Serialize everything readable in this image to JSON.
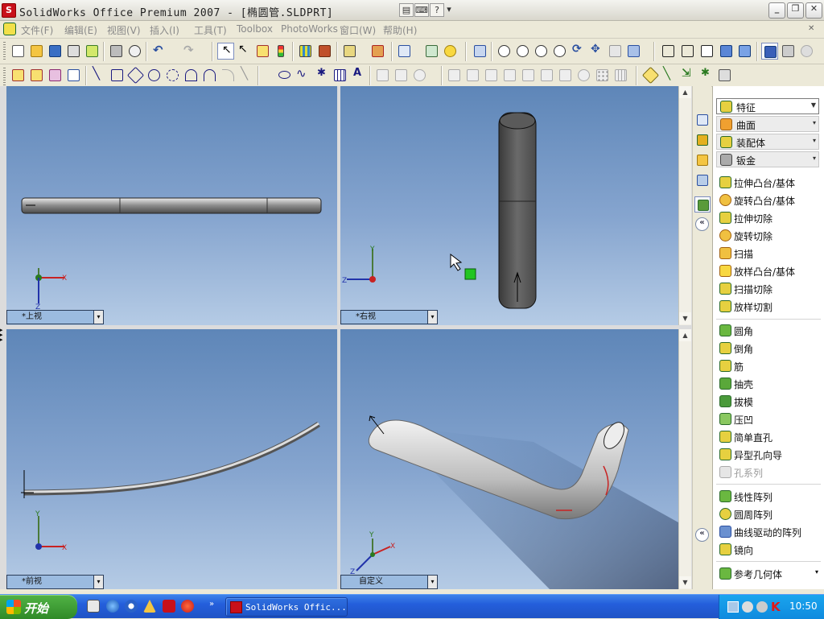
{
  "window": {
    "title": "SolidWorks Office Premium 2007 - [椭圆管.SLDPRT]",
    "logo_text": "S"
  },
  "menu": [
    "文件(F)",
    "编辑(E)",
    "视图(V)",
    "插入(I)",
    "工具(T)",
    "Toolbox",
    "PhotoWorks",
    "窗口(W)",
    "帮助(H)"
  ],
  "viewports": {
    "top_left": {
      "label": "*上视"
    },
    "top_right": {
      "label": "*右视"
    },
    "bottom_left": {
      "label": "*前视"
    },
    "bottom_right": {
      "label": "自定义"
    }
  },
  "axis_labels": {
    "x": "X",
    "y": "Y",
    "z": "Z"
  },
  "panel": {
    "groups": [
      "特征",
      "曲面",
      "装配体",
      "钣金"
    ],
    "features_1": [
      "拉伸凸台/基体",
      "旋转凸台/基体",
      "拉伸切除",
      "旋转切除",
      "扫描",
      "放样凸台/基体",
      "扫描切除",
      "放样切割"
    ],
    "features_2": [
      "圆角",
      "倒角",
      "筋",
      "抽壳",
      "拔模",
      "压凹",
      "简单直孔",
      "异型孔向导",
      "孔系列"
    ],
    "features_3": [
      "线性阵列",
      "圆周阵列",
      "曲线驱动的阵列",
      "镜向"
    ],
    "features_4": [
      "参考几何体"
    ]
  },
  "taskbar": {
    "start": "开始",
    "app": "SolidWorks Offic...",
    "clock": "10:50"
  },
  "colors": {
    "viewport_top": "#5e86b8",
    "viewport_bottom": "#b5cbe5",
    "taskbar": "#245edb",
    "start": "#3b9a30",
    "logo": "#c8101a"
  }
}
